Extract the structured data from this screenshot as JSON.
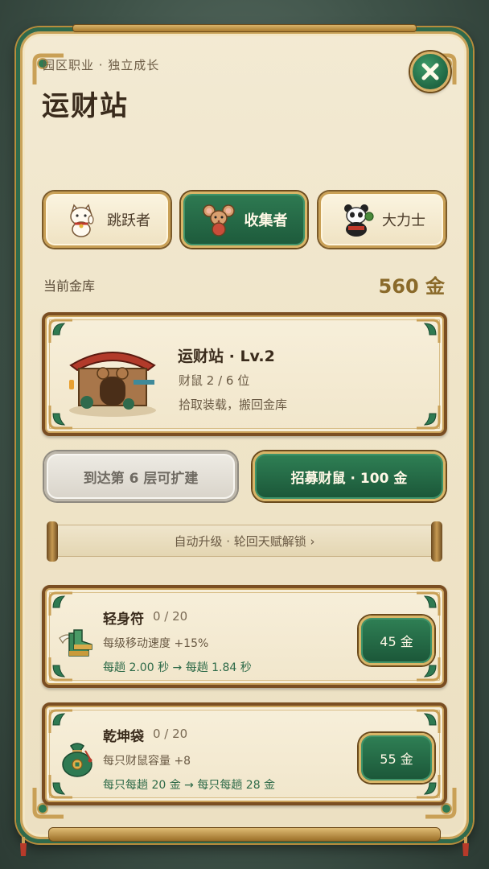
{
  "header": {
    "breadcrumb": "园区职业 · 独立成长",
    "title": "运财站"
  },
  "tabs": [
    {
      "label": "跳跃者",
      "icon": "lucky-cat-icon",
      "active": false
    },
    {
      "label": "收集者",
      "icon": "mouse-icon",
      "active": true
    },
    {
      "label": "大力士",
      "icon": "panda-icon",
      "active": false
    }
  ],
  "vault": {
    "label": "当前金库",
    "value": "560 金"
  },
  "station": {
    "name": "运财站 · Lv.2",
    "mice": "财鼠 2 / 6 位",
    "desc": "拾取装载，搬回金库"
  },
  "actions": {
    "expand_label": "到达第 6 层可扩建",
    "recruit_label": "招募财鼠 · 100 金"
  },
  "scroll_banner": "自动升级 · 轮回天赋解锁 ›",
  "upgrades": [
    {
      "name": "轻身符",
      "count": "0 / 20",
      "desc": "每级移动速度 +15%",
      "change": "每趟 2.00 秒 → 每趟 1.84 秒",
      "price": "45 金",
      "icon": "winged-boots-icon"
    },
    {
      "name": "乾坤袋",
      "count": "0 / 20",
      "desc": "每只财鼠容量 +8",
      "change": "每只每趟 20 金 → 每只每趟 28 金",
      "price": "55 金",
      "icon": "money-bag-icon"
    }
  ],
  "colors": {
    "accent_green": "#1f6643",
    "gold_trim": "#d8b567",
    "parchment": "#f3ead3",
    "text_dark": "#3a2b1c"
  }
}
